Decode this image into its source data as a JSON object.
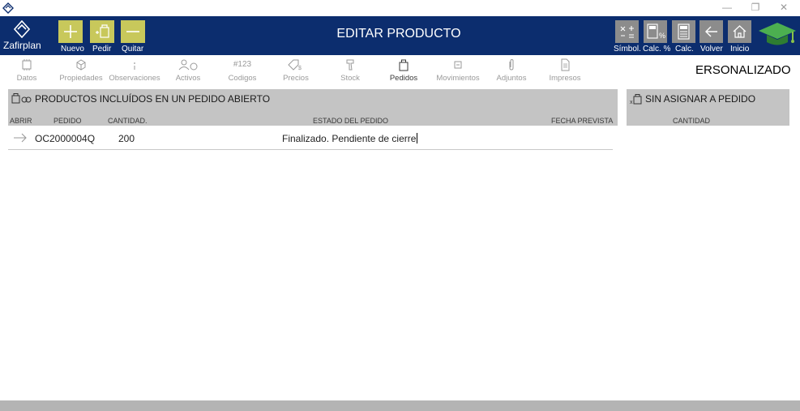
{
  "window": {
    "minimize_glyph": "—",
    "restore_glyph": "❐",
    "close_glyph": "✕"
  },
  "header": {
    "brand": "Zafirplan",
    "title": "EDITAR PRODUCTO",
    "left_buttons": [
      {
        "label": "Nuevo",
        "icon": "plus-icon"
      },
      {
        "label": "Pedir",
        "icon": "add-order-icon"
      },
      {
        "label": "Quitar",
        "icon": "minus-icon"
      }
    ],
    "right_buttons": [
      {
        "label": "Símbol.",
        "icon": "symbols-icon"
      },
      {
        "label": "Calc. %",
        "icon": "percent-calculator-icon"
      },
      {
        "label": "Calc.",
        "icon": "calculator-icon"
      },
      {
        "label": "Volver",
        "icon": "back-arrow-icon"
      },
      {
        "label": "Inicio",
        "icon": "home-icon"
      }
    ],
    "accent_color": "#c8c85b",
    "bar_color": "#0c2d6e"
  },
  "tabs": [
    {
      "label": "Datos",
      "icon": "datos-icon"
    },
    {
      "label": "Propiedades",
      "icon": "box-icon"
    },
    {
      "label": "Observaciones",
      "icon": "info-icon"
    },
    {
      "label": "Activos",
      "icon": "activos-icon"
    },
    {
      "label": "Codigos",
      "icon_text": "#123"
    },
    {
      "label": "Precios",
      "icon": "price-tag-icon"
    },
    {
      "label": "Stock",
      "icon": "stock-icon"
    },
    {
      "label": "Pedidos",
      "icon": "bag-icon",
      "active": true
    },
    {
      "label": "Movimientos",
      "icon": "movements-icon"
    },
    {
      "label": "Adjuntos",
      "icon": "paperclip-icon"
    },
    {
      "label": "Impresos",
      "icon": "document-icon"
    }
  ],
  "personalizado": "ERSONALIZADO",
  "open_orders": {
    "title": "PRODUCTOS INCLUÍDOS EN UN PEDIDO ABIERTO",
    "columns": [
      "ABRIR",
      "PEDIDO",
      "CANTIDAD.",
      "ESTADO DEL PEDIDO",
      "FECHA PREVISTA"
    ],
    "rows": [
      {
        "pedido": "OC2000004Q",
        "cantidad": "200",
        "estado": "Finalizado. Pendiente de cierre"
      }
    ]
  },
  "unassigned": {
    "title": "SIN ASIGNAR A PEDIDO",
    "columns": [
      "CANTIDAD"
    ]
  }
}
